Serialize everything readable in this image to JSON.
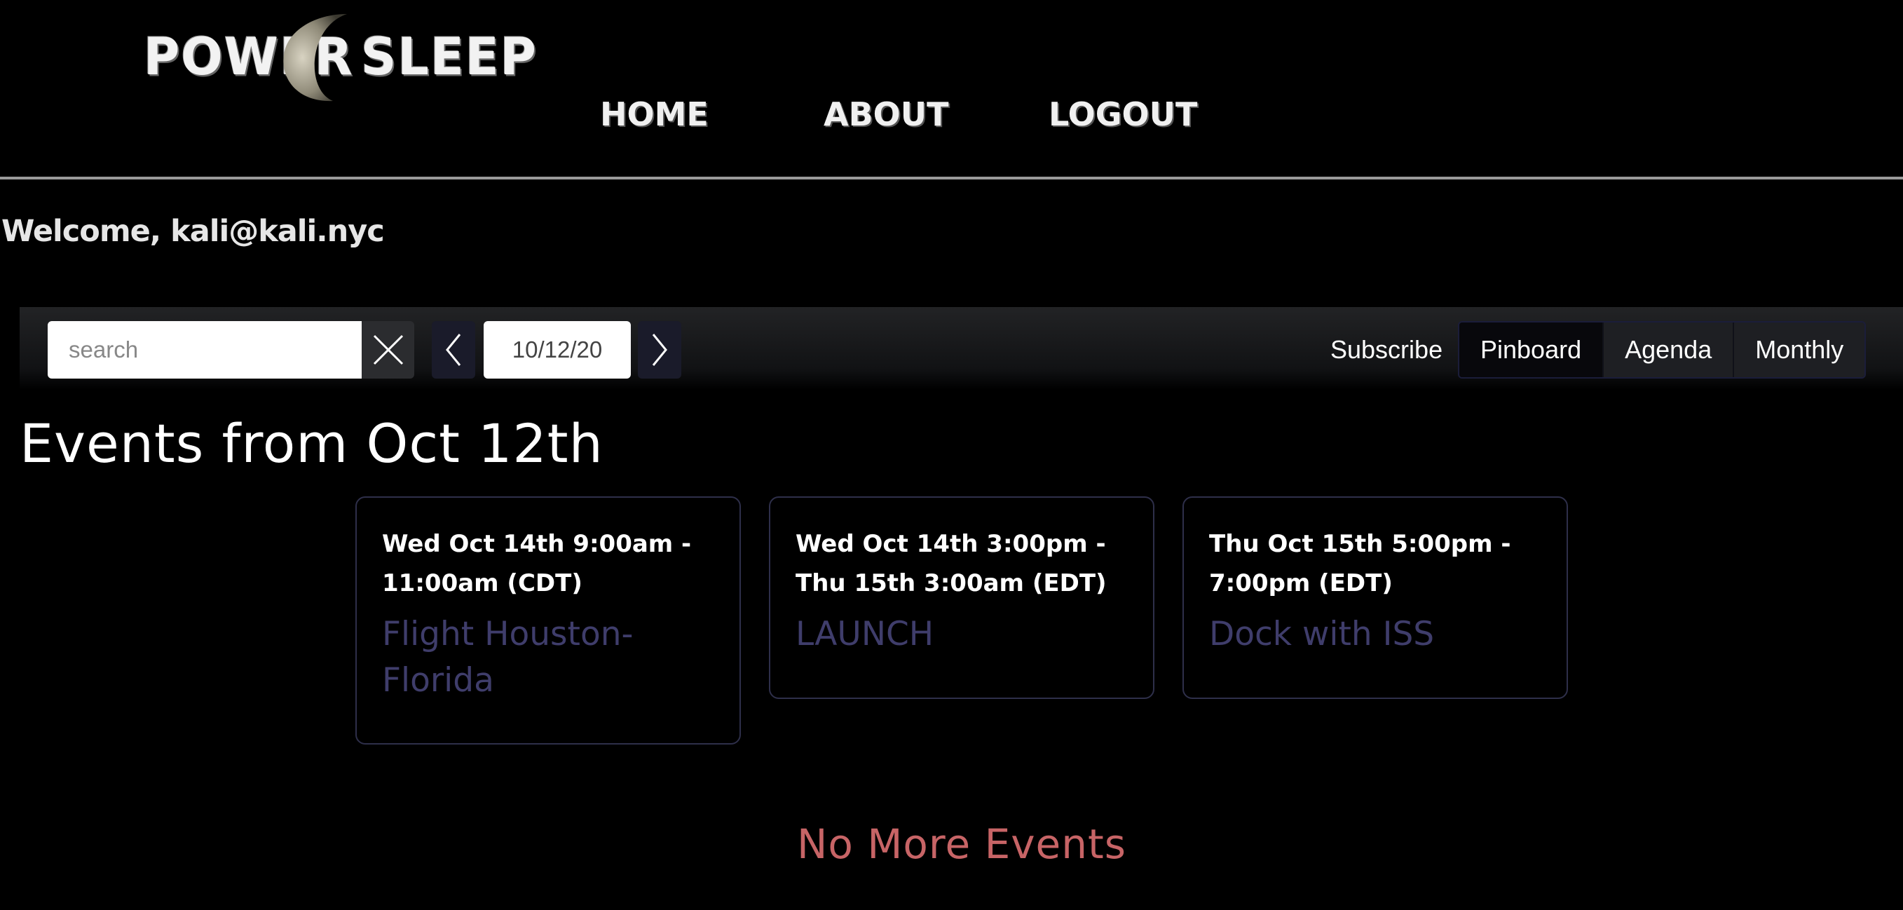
{
  "header": {
    "logo_word_1": "POWER",
    "logo_word_2": "SLEEP",
    "nav": {
      "home": "HOME",
      "about": "ABOUT",
      "logout": "LOGOUT"
    }
  },
  "welcome": "Welcome, kali@kali.nyc",
  "toolbar": {
    "search_placeholder": "search",
    "search_value": "",
    "date": "10/12/20",
    "subscribe": "Subscribe",
    "views": [
      {
        "label": "Pinboard",
        "active": true
      },
      {
        "label": "Agenda",
        "active": false
      },
      {
        "label": "Monthly",
        "active": false
      }
    ]
  },
  "events": {
    "heading": "Events from Oct 12th",
    "items": [
      {
        "time": "Wed Oct 14th 9:00am - 11:00am (CDT)",
        "title": "Flight Houston-Florida"
      },
      {
        "time": "Wed Oct 14th 3:00pm - Thu 15th 3:00am (EDT)",
        "title": "LAUNCH"
      },
      {
        "time": "Thu Oct 15th 5:00pm - 7:00pm (EDT)",
        "title": "Dock with ISS"
      }
    ],
    "footer": "No More Events"
  },
  "colors": {
    "background": "#000000",
    "card_border": "#2e2f4a",
    "card_title": "#3f3d6b",
    "no_more_events": "#c76466"
  },
  "icons": [
    "close-icon",
    "chevron-left-icon",
    "chevron-right-icon",
    "moon-icon"
  ]
}
